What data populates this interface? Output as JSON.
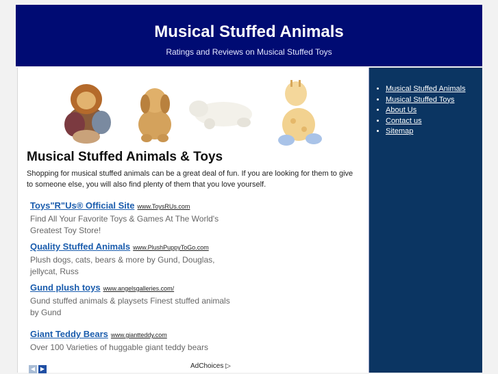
{
  "header": {
    "title": "Musical Stuffed Animals",
    "tagline": "Ratings and Reviews on Musical Stuffed Toys"
  },
  "sidebar": {
    "items": [
      {
        "label": "Musical Stuffed Animals"
      },
      {
        "label": "Musical Stuffed Toys"
      },
      {
        "label": "About Us"
      },
      {
        "label": "Contact us"
      },
      {
        "label": "Sitemap"
      }
    ]
  },
  "main": {
    "heading": "Musical Stuffed Animals & Toys",
    "intro": "Shopping for musical stuffed animals can be a great deal of fun. If you are looking for them to give to someone else, you will also find plenty of them that you love yourself."
  },
  "ads": [
    {
      "title": "Toys\"R\"Us® Official Site",
      "url": "www.ToysRUs.com",
      "desc": "Find All Your Favorite Toys & Games At The World's Greatest Toy Store!"
    },
    {
      "title": "Quality Stuffed Animals",
      "url": "www.PlushPuppyToGo.com",
      "desc": "Plush dogs, cats, bears & more by Gund, Douglas, jellycat, Russ"
    },
    {
      "title": "Gund plush toys",
      "url": "www.angelsgalleries.com/",
      "desc": "Gund stuffed animals & playsets Finest stuffed animals by Gund"
    },
    {
      "title": "Giant Teddy Bears",
      "url": "www.giantteddy.com",
      "desc": "Over 100 Varieties of huggable giant teddy bears"
    }
  ],
  "adchoices": {
    "label": "AdChoices"
  }
}
